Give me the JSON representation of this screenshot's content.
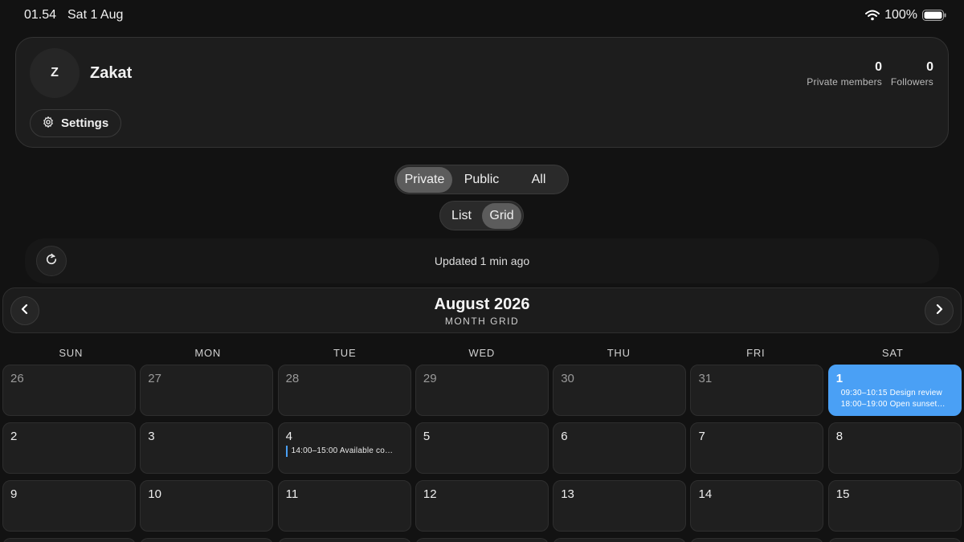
{
  "status": {
    "time": "01.54",
    "date": "Sat 1 Aug",
    "battery": "100%",
    "icons": [
      "wifi-icon",
      "battery-icon"
    ]
  },
  "profile": {
    "avatar_letter": "Z",
    "name": "Zakat",
    "settings_label": "Settings",
    "stats": [
      {
        "value": "0",
        "label": "Private members"
      },
      {
        "value": "0",
        "label": "Followers"
      }
    ]
  },
  "visibility": {
    "options": [
      "Private",
      "Public",
      "All"
    ],
    "selected": "Private"
  },
  "view": {
    "options": [
      "List",
      "Grid"
    ],
    "selected": "Grid"
  },
  "update": {
    "text": "Updated 1 min ago"
  },
  "calendar": {
    "title": "August 2026",
    "subtitle": "MONTH GRID",
    "weekdays": [
      "SUN",
      "MON",
      "TUE",
      "WED",
      "THU",
      "FRI",
      "SAT"
    ],
    "days": [
      {
        "number": "26",
        "other": true,
        "events": []
      },
      {
        "number": "27",
        "other": true,
        "events": []
      },
      {
        "number": "28",
        "other": true,
        "events": []
      },
      {
        "number": "29",
        "other": true,
        "events": []
      },
      {
        "number": "30",
        "other": true,
        "events": []
      },
      {
        "number": "31",
        "other": true,
        "events": []
      },
      {
        "number": "1",
        "today": true,
        "events": [
          "09:30–10:15 Design review",
          "18:00–19:00 Open sunset…"
        ]
      },
      {
        "number": "2",
        "events": []
      },
      {
        "number": "3",
        "events": []
      },
      {
        "number": "4",
        "events": [
          "14:00–15:00 Available co…"
        ]
      },
      {
        "number": "5",
        "events": []
      },
      {
        "number": "6",
        "events": []
      },
      {
        "number": "7",
        "events": []
      },
      {
        "number": "8",
        "events": []
      },
      {
        "number": "9",
        "events": []
      },
      {
        "number": "10",
        "events": []
      },
      {
        "number": "11",
        "events": []
      },
      {
        "number": "12",
        "events": []
      },
      {
        "number": "13",
        "events": []
      },
      {
        "number": "14",
        "events": []
      },
      {
        "number": "15",
        "events": []
      }
    ]
  },
  "colors": {
    "accent": "#4aa0f5",
    "background": "#121212",
    "card": "#1d1d1d"
  }
}
